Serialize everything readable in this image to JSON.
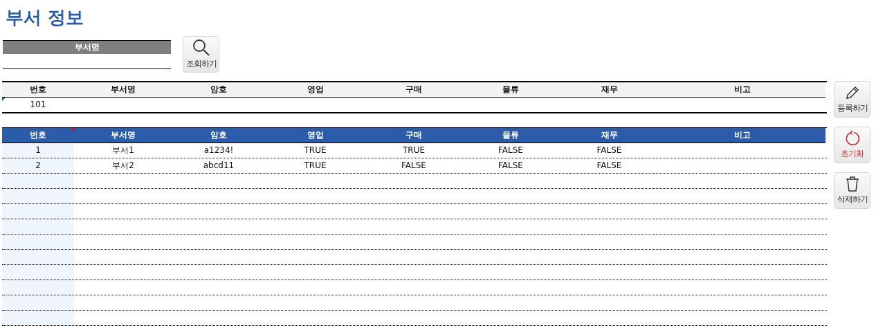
{
  "title": "부서 정보",
  "search": {
    "label": "부서명",
    "button": "조회하기"
  },
  "entry": {
    "columns": [
      "번호",
      "부서명",
      "암호",
      "영업",
      "구매",
      "물류",
      "재무",
      "비고"
    ],
    "row": [
      "101"
    ]
  },
  "table": {
    "columns": [
      "번호",
      "부서명",
      "암호",
      "영업",
      "구매",
      "물류",
      "재무",
      "비고"
    ],
    "rows": [
      [
        "1",
        "부서1",
        "a1234!",
        "TRUE",
        "TRUE",
        "FALSE",
        "FALSE"
      ],
      [
        "2",
        "부서2",
        "abcd11",
        "TRUE",
        "FALSE",
        "FALSE",
        "FALSE"
      ]
    ]
  },
  "actions": [
    {
      "label": "등록하기",
      "kind": "pencil"
    },
    {
      "label": "초기화",
      "kind": "reset"
    },
    {
      "label": "삭제하기",
      "kind": "trash"
    }
  ]
}
